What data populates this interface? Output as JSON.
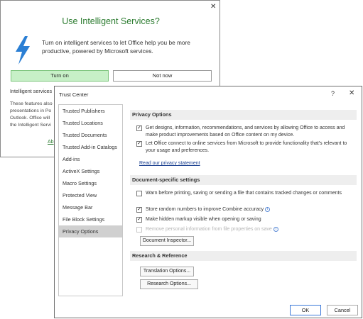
{
  "back_dialog": {
    "close_glyph": "✕",
    "title": "Use Intelligent Services?",
    "message": "Turn on intelligent services to let Office help you be more productive, powered by Microsoft services.",
    "turn_on_label": "Turn on",
    "not_now_label": "Not now",
    "subheading": "Intelligent services",
    "body_lines": [
      "These features also",
      "presentations in Po",
      "Outlook. Office will",
      "the Intelligent Servi"
    ],
    "link": "Ab",
    "accent_color": "#2e7d32",
    "icon": "lightning-icon"
  },
  "trust_center": {
    "title": "Trust Center",
    "help_glyph": "?",
    "close_glyph": "✕",
    "nav_items": [
      "Trusted Publishers",
      "Trusted Locations",
      "Trusted Documents",
      "Trusted Add-in Catalogs",
      "Add-ins",
      "ActiveX Settings",
      "Macro Settings",
      "Protected View",
      "Message Bar",
      "File Block Settings",
      "Privacy Options"
    ],
    "active_nav": "Privacy Options",
    "sections": {
      "privacy": {
        "heading": "Privacy Options",
        "options": [
          {
            "label": "Get designs, information, recommendations, and services by allowing Office to access and make product improvements based on Office content on my device.",
            "checked": true
          },
          {
            "label": "Let Office connect to online services from Microsoft to provide functionality that's relevant to your usage and preferences.",
            "checked": true
          }
        ],
        "link": "Read our privacy statement"
      },
      "document": {
        "heading": "Document-specific settings",
        "options": [
          {
            "label": "Warn before printing, saving or sending a file that contains tracked changes or comments",
            "checked": false,
            "disabled": false
          },
          {
            "label": "Store random numbers to improve Combine accuracy",
            "checked": true,
            "disabled": false
          },
          {
            "label": "Make hidden markup visible when opening or saving",
            "checked": true,
            "disabled": false
          },
          {
            "label": "Remove personal information from file properties on save",
            "checked": false,
            "disabled": true
          }
        ],
        "document_inspector_label": "Document Inspector..."
      },
      "research": {
        "heading": "Research & Reference",
        "translation_label": "Translation Options...",
        "research_label": "Research Options..."
      }
    },
    "ok_label": "OK",
    "cancel_label": "Cancel",
    "check_glyph": "✓",
    "info_glyph": "i"
  }
}
